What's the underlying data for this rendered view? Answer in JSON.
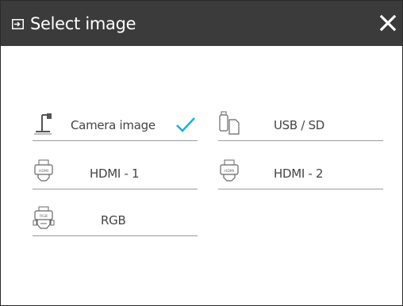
{
  "dialog": {
    "title": "Select image",
    "close_label": "close",
    "accent_color": "#1ab0e8"
  },
  "options": [
    {
      "label": "Camera image",
      "icon": "document-camera-icon",
      "selected": true
    },
    {
      "label": "USB / SD",
      "icon": "usb-sd-icon",
      "selected": false
    },
    {
      "label": "HDMI - 1",
      "icon": "hdmi-icon",
      "selected": false
    },
    {
      "label": "HDMI - 2",
      "icon": "hdmi-icon",
      "selected": false
    },
    {
      "label": "RGB",
      "icon": "vga-connector-icon",
      "selected": false
    }
  ]
}
